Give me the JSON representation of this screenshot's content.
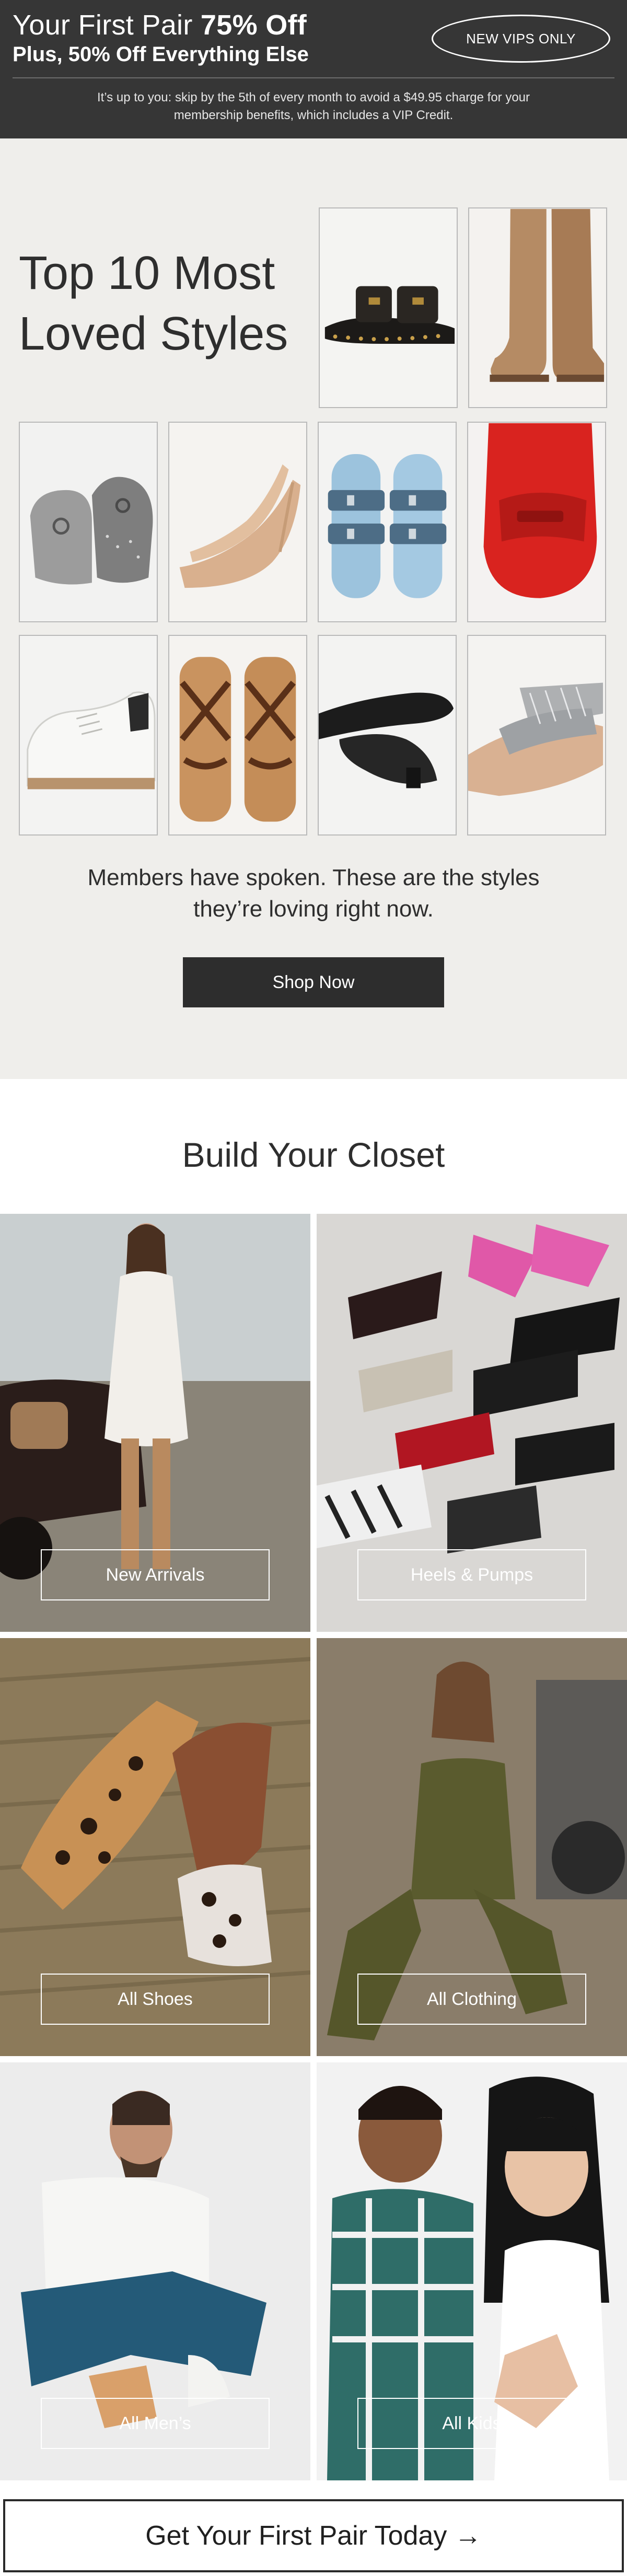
{
  "banner": {
    "headline_regular": "Your First Pair ",
    "headline_bold": "75% Off",
    "subhead": "Plus, 50% Off Everything Else",
    "vip_pill": "NEW VIPS ONLY",
    "terms": "It’s up to you: skip by the 5th of every month to avoid a $49.95 charge for your membership benefits, which includes a VIP Credit."
  },
  "loved": {
    "title": "Top 10 Most Loved Styles",
    "blurb": "Members have spoken. These are the styles they’re loving right now.",
    "shop_button": "Shop Now",
    "products": [
      {
        "icon": "studded-slide-sandal-icon"
      },
      {
        "icon": "tan-knee-boot-icon"
      },
      {
        "icon": "grey-clog-icon"
      },
      {
        "icon": "nude-pump-icon"
      },
      {
        "icon": "blue-buckle-slide-icon"
      },
      {
        "icon": "red-loafer-icon"
      },
      {
        "icon": "white-sneaker-icon"
      },
      {
        "icon": "strappy-flat-sandal-icon"
      },
      {
        "icon": "black-flat-icon"
      },
      {
        "icon": "rhinestone-slide-icon"
      }
    ]
  },
  "closet": {
    "title": "Build Your Closet",
    "categories": [
      {
        "label": "New Arrivals"
      },
      {
        "label": "Heels & Pumps"
      },
      {
        "label": "All Shoes"
      },
      {
        "label": "All Clothing"
      },
      {
        "label": "All Men’s"
      },
      {
        "label": "All Kids"
      }
    ]
  },
  "cta": {
    "label": "Get Your First Pair Today →"
  }
}
